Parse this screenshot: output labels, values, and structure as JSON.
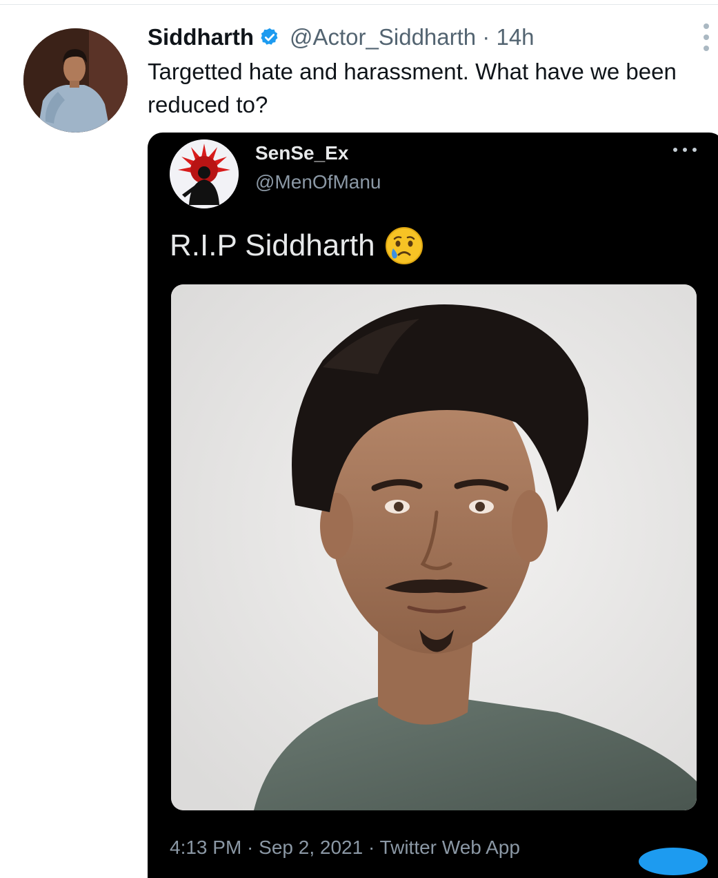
{
  "author": {
    "display_name": "Siddharth",
    "handle_meta": "@Actor_Siddharth · 14h",
    "avatar_icon": "profile-photo"
  },
  "tweet": {
    "text": "Targetted hate and harassment. What have we been reduced to?"
  },
  "quoted": {
    "display_name": "SenSe_Ex",
    "handle": "@MenOfManu",
    "text": "R.I.P Siddharth",
    "emoji_icon": "crying-face-icon",
    "footer": "4:13 PM · Sep 2, 2021 · Twitter Web App"
  },
  "colors": {
    "verified": "#1d9bf0",
    "text_primary": "#0f1419",
    "text_secondary": "#536471",
    "dark_bg": "#000000"
  }
}
